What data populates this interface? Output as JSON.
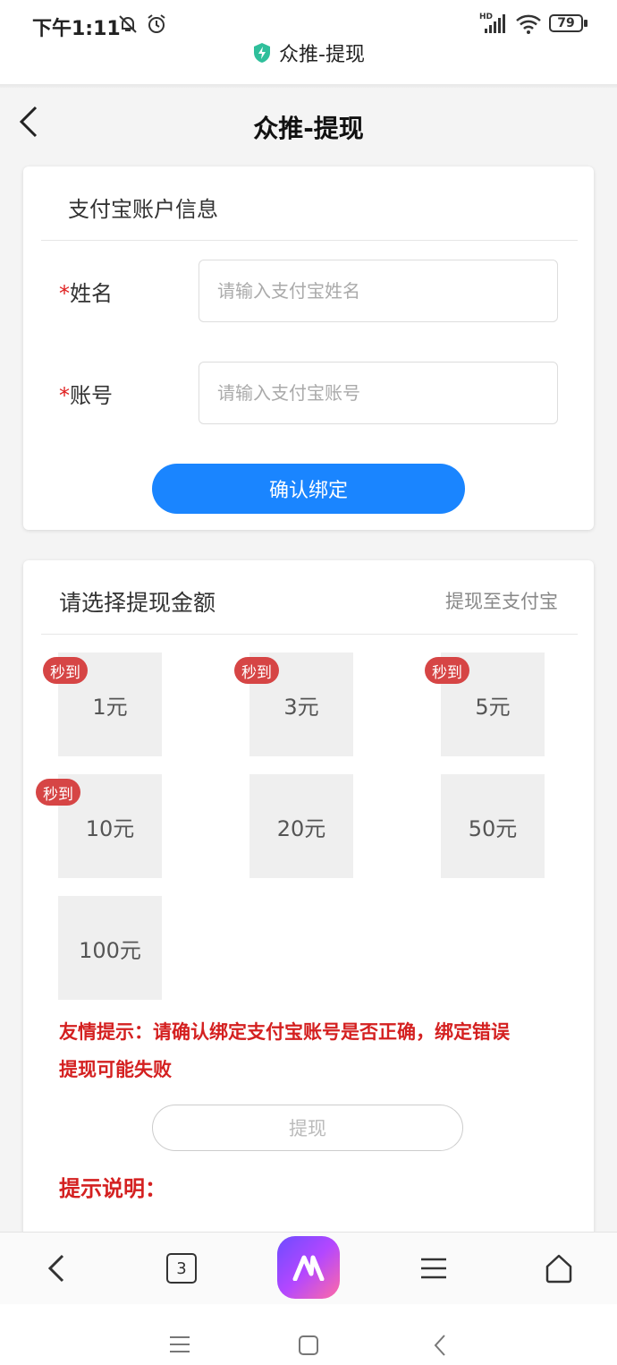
{
  "status_bar": {
    "time": "下午1:11",
    "battery": "79",
    "network_label": "HD",
    "page_label": "众推-提现"
  },
  "header": {
    "title": "众推-提现"
  },
  "alipay_card": {
    "heading": "支付宝账户信息",
    "name_label": "姓名",
    "name_placeholder": "请输入支付宝姓名",
    "account_label": "账号",
    "account_placeholder": "请输入支付宝账号",
    "required_mark": "*",
    "bind_button": "确认绑定"
  },
  "withdraw_card": {
    "heading": "请选择提现金额",
    "destination": "提现至支付宝",
    "badge_text": "秒到",
    "amounts": [
      {
        "label": "1元",
        "instant": true
      },
      {
        "label": "3元",
        "instant": true
      },
      {
        "label": "5元",
        "instant": true
      },
      {
        "label": "10元",
        "instant": true
      },
      {
        "label": "20元",
        "instant": false
      },
      {
        "label": "50元",
        "instant": false
      },
      {
        "label": "100元",
        "instant": false
      }
    ],
    "tip_line1": "友情提示：请确认绑定支付宝账号是否正确，绑定错误",
    "tip_line2": "提现可能失败",
    "withdraw_button": "提现",
    "notes_title": "提示说明："
  },
  "browser_bar": {
    "tab_count": "3"
  },
  "colors": {
    "primary_blue": "#1a85ff",
    "warning_red": "#d42020",
    "badge_red": "#d64545"
  },
  "icons": [
    "mute-icon",
    "alarm-icon",
    "signal-icon",
    "wifi-icon",
    "battery-icon",
    "shield-bolt-icon",
    "back-arrow-icon",
    "home-icon",
    "menu-icon",
    "app-logo-icon"
  ]
}
